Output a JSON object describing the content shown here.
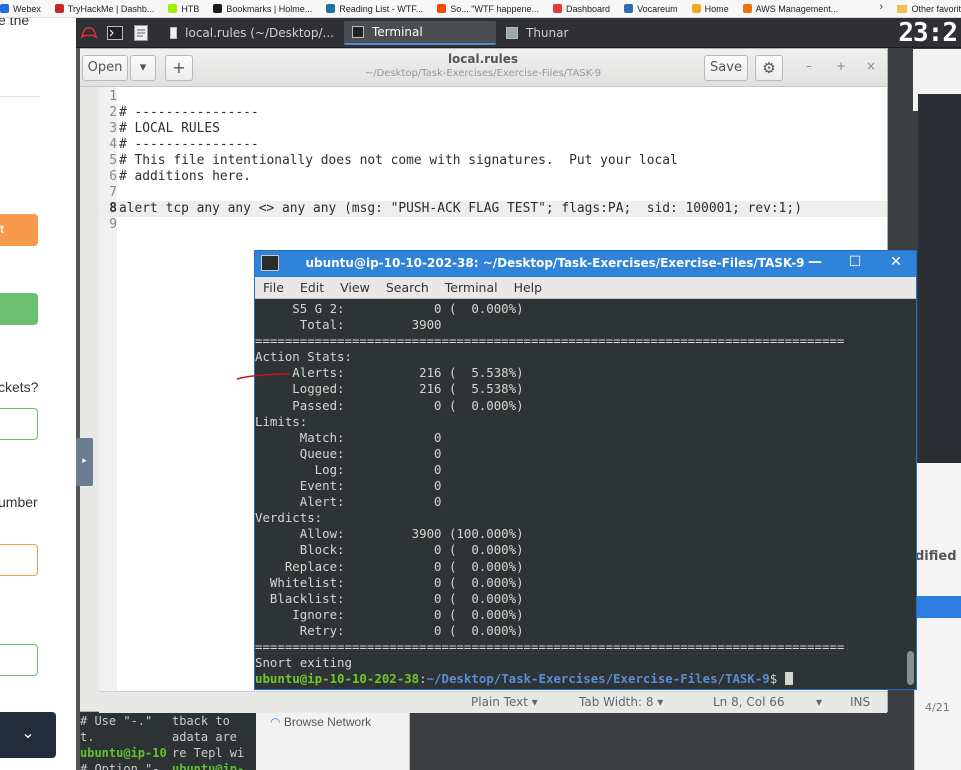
{
  "bookmarks": {
    "items": [
      {
        "label": "Webex",
        "color": "#1e6fd9"
      },
      {
        "label": "TryHackMe | Dashb...",
        "color": "#c4282a"
      },
      {
        "label": "HTB",
        "color": "#9fef00"
      },
      {
        "label": "Bookmarks | Holme...",
        "color": "#1b1b1b"
      },
      {
        "label": "Reading List - WTF...",
        "color": "#21759b"
      },
      {
        "label": "So... \"WTF happene...",
        "color": "#ff4500"
      },
      {
        "label": "Dashboard",
        "color": "#e03a3a"
      },
      {
        "label": "Vocareum",
        "color": "#2a6fb0"
      },
      {
        "label": "Home",
        "color": "#f5a623"
      },
      {
        "label": "AWS Management...",
        "color": "#ec7211"
      }
    ],
    "overflow": "›",
    "other": "Other favorit"
  },
  "left_page": {
    "top_text": "e the",
    "btn_orange": "t",
    "q1": "ckets?",
    "q2": "umber",
    "dropdown": "⌄"
  },
  "taskbar": {
    "tasks": [
      {
        "label": "local.rules (~/Desktop/...",
        "active": false
      },
      {
        "label": "Terminal",
        "active": true
      },
      {
        "label": "Thunar",
        "active": false
      }
    ],
    "clock": "23:2"
  },
  "gedit": {
    "open_label": "Open",
    "dropdown_glyph": "▾",
    "new_tab": "+",
    "title": "local.rules",
    "path": "~/Desktop/Task-Exercises/Exercise-Files/TASK-9",
    "save_label": "Save",
    "settings_glyph": "⚙",
    "minimize": "–",
    "maximize": "+",
    "close": "×",
    "lines": [
      {
        "n": "1",
        "text": ""
      },
      {
        "n": "2",
        "text": "# ----------------"
      },
      {
        "n": "3",
        "text": "# LOCAL RULES"
      },
      {
        "n": "4",
        "text": "# ----------------"
      },
      {
        "n": "5",
        "text": "# This file intentionally does not come with signatures.  Put your local"
      },
      {
        "n": "6",
        "text": "# additions here."
      },
      {
        "n": "7",
        "text": ""
      },
      {
        "n": "8",
        "text": "alert tcp any any <> any any (msg: \"PUSH-ACK FLAG TEST\"; flags:PA;  sid: 100001; rev:1;)"
      },
      {
        "n": "9",
        "text": ""
      }
    ],
    "current_line": 8,
    "status": {
      "lang": "Plain Text ▾",
      "tab": "Tab Width: 8 ▾",
      "pos": "Ln 8, Col 66",
      "ins": "INS",
      "arrow": "▾"
    }
  },
  "terminal": {
    "title": "ubuntu@ip-10-10-202-38: ~/Desktop/Task-Exercises/Exercise-Files/TASK-9",
    "minimize": "—",
    "maximize": "☐",
    "close": "✕",
    "menu": [
      "File",
      "Edit",
      "View",
      "Search",
      "Terminal",
      "Help"
    ],
    "output": [
      "     S5 G 2:            0 (  0.000%)",
      "      Total:         3900",
      "===============================================================================",
      "Action Stats:",
      "     Alerts:          216 (  5.538%)",
      "     Logged:          216 (  5.538%)",
      "     Passed:            0 (  0.000%)",
      "Limits:",
      "      Match:            0",
      "      Queue:            0",
      "        Log:            0",
      "      Event:            0",
      "      Alert:            0",
      "Verdicts:",
      "      Allow:         3900 (100.000%)",
      "      Block:            0 (  0.000%)",
      "    Replace:            0 (  0.000%)",
      "  Whitelist:            0 (  0.000%)",
      "  Blacklist:            0 (  0.000%)",
      "     Ignore:            0 (  0.000%)",
      "      Retry:            0 (  0.000%)",
      "===============================================================================",
      "Snort exiting"
    ],
    "prompt_user": "ubuntu@ip-10-10-202-38",
    "prompt_sep": ":",
    "prompt_path": "~/Desktop/Task-Exercises/Exercise-Files/TASK-9",
    "prompt_end": "$ "
  },
  "background": {
    "term_lines": [
      {
        "text": "# Use \"-.\" ",
        "green": false
      },
      {
        "text": "t.",
        "green": false
      },
      {
        "text": "ubuntu@ip-10",
        "green": true
      },
      {
        "text": "# Option \"-.",
        "green": false
      }
    ],
    "term_lines2": [
      {
        "text": "tback to ",
        "green": false
      },
      {
        "text": "adata are",
        "green": false
      },
      {
        "text": "re Tepl wi",
        "green": false
      },
      {
        "text": "ubuntu@ip-",
        "green": true
      }
    ],
    "browse_network": "Browse Network",
    "modified": "dified",
    "page_frac": "4/21"
  }
}
